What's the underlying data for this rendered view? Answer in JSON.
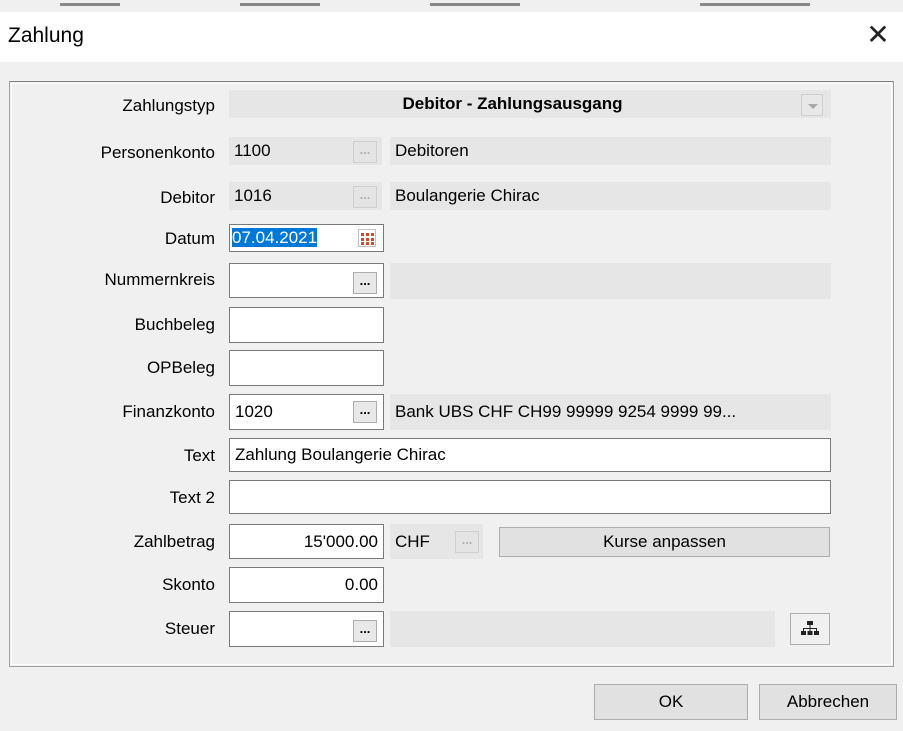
{
  "dialog": {
    "title": "Zahlung",
    "close_glyph": "✕"
  },
  "form": {
    "zahlungstyp": {
      "label": "Zahlungstyp",
      "value": "Debitor - Zahlungsausgang"
    },
    "personenkonto": {
      "label": "Personenkonto",
      "value": "1100",
      "description": "Debitoren"
    },
    "debitor": {
      "label": "Debitor",
      "value": "1016",
      "description": "Boulangerie Chirac"
    },
    "datum": {
      "label": "Datum",
      "value": "07.04.2021"
    },
    "nummernkreis": {
      "label": "Nummernkreis",
      "value": ""
    },
    "buchbeleg": {
      "label": "Buchbeleg",
      "value": ""
    },
    "opbeleg": {
      "label": "OPBeleg",
      "value": ""
    },
    "finanzkonto": {
      "label": "Finanzkonto",
      "value": "1020",
      "description": "Bank UBS CHF CH99 99999 9254 9999 99..."
    },
    "text": {
      "label": "Text",
      "value": "Zahlung Boulangerie Chirac"
    },
    "text2": {
      "label": "Text 2",
      "value": ""
    },
    "zahlbetrag": {
      "label": "Zahlbetrag",
      "value": "15'000.00",
      "currency": "CHF",
      "rates_button": "Kurse anpassen"
    },
    "skonto": {
      "label": "Skonto",
      "value": "0.00"
    },
    "steuer": {
      "label": "Steuer",
      "value": "",
      "description": ""
    },
    "ellipsis": "..."
  },
  "buttons": {
    "ok": "OK",
    "cancel": "Abbrechen"
  },
  "icons": {
    "calendar": "calendar-icon",
    "hierarchy": "hierarchy-icon",
    "dropdown": "chevron-down-icon"
  }
}
